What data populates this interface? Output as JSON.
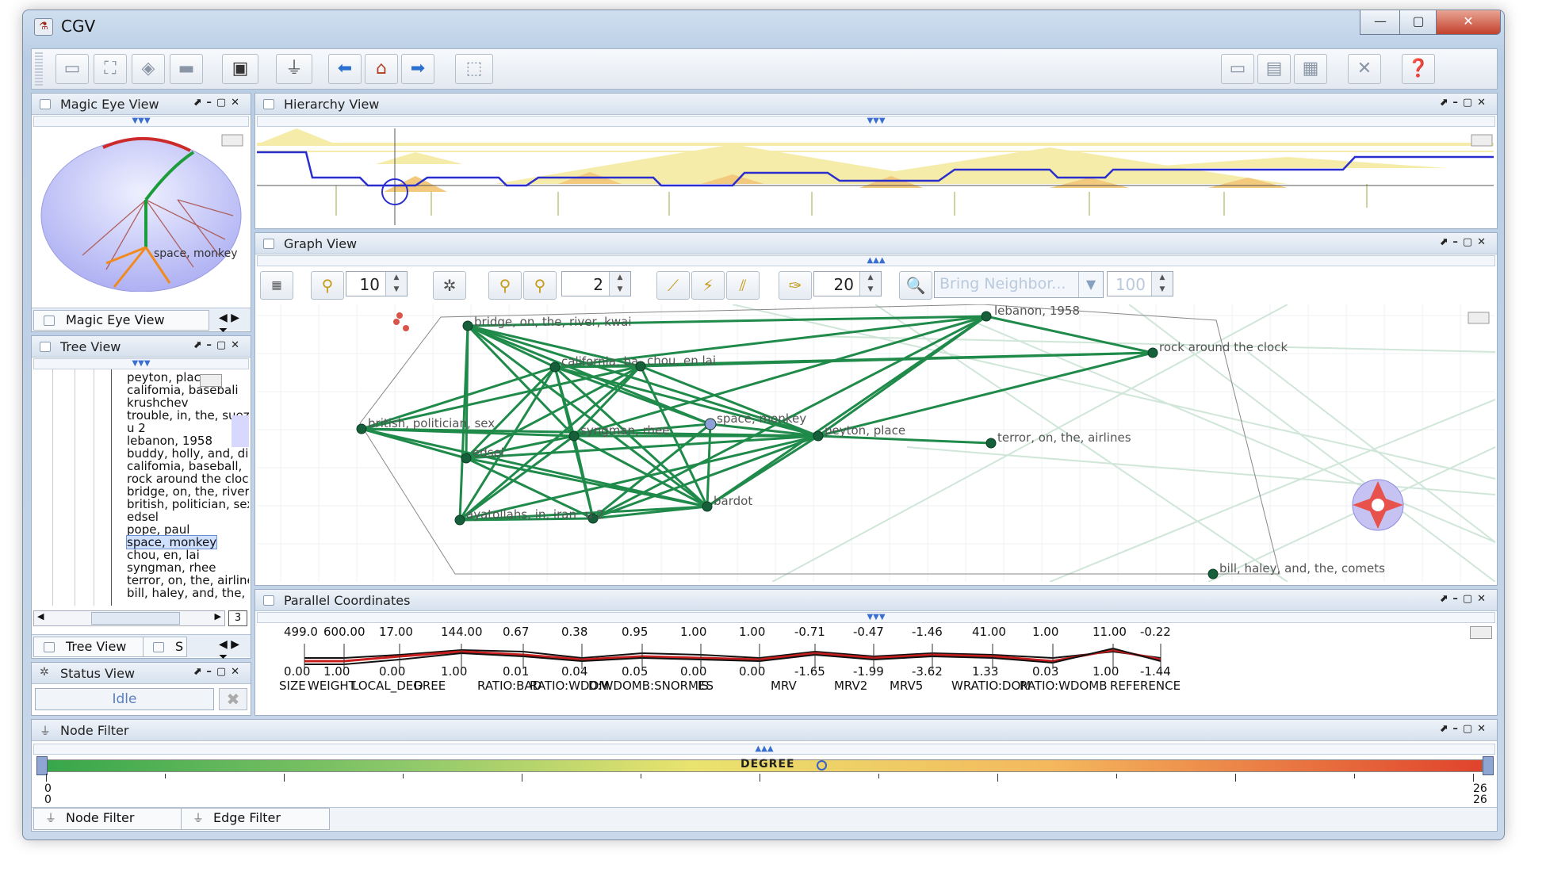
{
  "window": {
    "title": "CGV",
    "controls": {
      "minimize": "—",
      "maximize": "▢",
      "close": "✕"
    }
  },
  "toolbar": {
    "icons": [
      "open-icon",
      "binoculars-icon",
      "layers-icon",
      "save-icon",
      "screenshot-icon",
      "filter-icon",
      "back-arrow-icon",
      "home-icon",
      "forward-arrow-icon",
      "select-icon",
      "export-icon",
      "comment-icon",
      "table-icon",
      "delete-icon",
      "help-icon"
    ]
  },
  "magic_eye": {
    "title": "Magic Eye View",
    "node_label": "space, monkey",
    "tab_label": "Magic Eye View"
  },
  "tree": {
    "title": "Tree View",
    "items": [
      "peyton, place",
      "califomia, basebali",
      "krushchev",
      "trouble, in, the, suez",
      "u 2",
      "lebanon, 1958",
      "buddy, holly, and, di",
      "califomia, baseball,",
      "rock around the cloc",
      "bridge, on, the, river",
      "british, politician, sex",
      "edsel",
      "pope, paul",
      "space, monkey",
      "chou, en, lai",
      "syngman, rhee",
      "terror, on, the, airline",
      "bill, haley, and, the,"
    ],
    "selected_index": 13,
    "page": "3",
    "tab_label": "Tree View",
    "tab2_label": "S"
  },
  "status": {
    "title": "Status View",
    "text": "Idle"
  },
  "hierarchy": {
    "title": "Hierarchy View"
  },
  "graph": {
    "title": "Graph View",
    "spin1": "10",
    "spin2": "2",
    "spin3": "20",
    "bring_placeholder": "Bring Neighbor...",
    "spin4": "100",
    "labels": [
      "bridge, on, the, river, kwai",
      "lebanon, 1958",
      "rock around the clock",
      "california, ba",
      "chou, en lai",
      "british, politician, sex",
      "syngman, rhee",
      "space, monkey",
      "peyton, place",
      "terror, on, the, airlines",
      "edsel",
      "bardot",
      "ayatollahs, in, iran",
      "u 2",
      "bill, haley, and, the, comets"
    ]
  },
  "parallel": {
    "title": "Parallel Coordinates",
    "top_values": [
      "499.0",
      "600.00",
      "17.00",
      "144.00",
      "0.67",
      "0.38",
      "0.95",
      "1.00",
      "1.00",
      "-0.71",
      "-0.47",
      "-1.46",
      "41.00",
      "1.00",
      "11.00",
      "-0.22"
    ],
    "bottom_values": [
      "0.00",
      "1.00",
      "0.00",
      "1.00",
      "0.01",
      "0.04",
      "0.05",
      "0.00",
      "0.00",
      "-1.65",
      "-1.99",
      "-3.62",
      "1.33",
      "0.03",
      "1.00",
      "-1.44"
    ],
    "axis_labels": [
      "SIZE",
      "WEIGHT",
      "LOCAL_DEGREE",
      "D",
      "RATIO:BAD",
      "RATIO:WDOM",
      "D:WDOMB:SNORMES",
      "IS",
      "MRV",
      "MRV2",
      "MRV5",
      "WRATIO:DOM",
      "RATIO:WDOMB",
      "REFERENCE"
    ]
  },
  "node_filter": {
    "title": "Node Filter",
    "slider_label": "DEGREE",
    "min_value": "0",
    "min_value2": "0",
    "max_value": "26",
    "max_value2": "26",
    "tab1": "Node Filter",
    "tab2": "Edge Filter"
  }
}
